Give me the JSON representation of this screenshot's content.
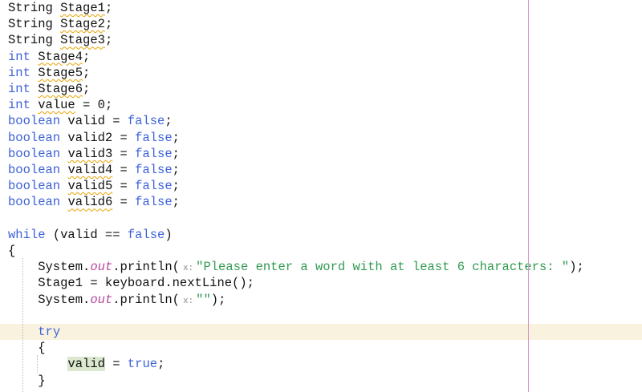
{
  "editor": {
    "current_line": 20,
    "lines": [
      [
        [
          "String ",
          ""
        ],
        [
          "Stage1",
          "w"
        ],
        [
          ";",
          ""
        ]
      ],
      [
        [
          "String ",
          ""
        ],
        [
          "Stage2",
          "w"
        ],
        [
          ";",
          ""
        ]
      ],
      [
        [
          "String ",
          ""
        ],
        [
          "Stage3",
          "w"
        ],
        [
          ";",
          ""
        ]
      ],
      [
        [
          "int",
          "k"
        ],
        [
          " ",
          ""
        ],
        [
          "Stage4",
          "w"
        ],
        [
          ";",
          ""
        ]
      ],
      [
        [
          "int",
          "k"
        ],
        [
          " ",
          ""
        ],
        [
          "Stage5",
          "w"
        ],
        [
          ";",
          ""
        ]
      ],
      [
        [
          "int",
          "k"
        ],
        [
          " ",
          ""
        ],
        [
          "Stage6",
          "w"
        ],
        [
          ";",
          ""
        ]
      ],
      [
        [
          "int",
          "k"
        ],
        [
          " ",
          ""
        ],
        [
          "value",
          "w"
        ],
        [
          " = 0;",
          ""
        ]
      ],
      [
        [
          "boolean",
          "k"
        ],
        [
          " valid = ",
          ""
        ],
        [
          "false",
          "k"
        ],
        [
          ";",
          ""
        ]
      ],
      [
        [
          "boolean",
          "k"
        ],
        [
          " valid2 = ",
          ""
        ],
        [
          "false",
          "k"
        ],
        [
          ";",
          ""
        ]
      ],
      [
        [
          "boolean",
          "k"
        ],
        [
          " ",
          ""
        ],
        [
          "valid3",
          "w"
        ],
        [
          " = ",
          ""
        ],
        [
          "false",
          "k"
        ],
        [
          ";",
          ""
        ]
      ],
      [
        [
          "boolean",
          "k"
        ],
        [
          " ",
          ""
        ],
        [
          "valid4",
          "w"
        ],
        [
          " = ",
          ""
        ],
        [
          "false",
          "k"
        ],
        [
          ";",
          ""
        ]
      ],
      [
        [
          "boolean",
          "k"
        ],
        [
          " ",
          ""
        ],
        [
          "valid5",
          "w"
        ],
        [
          " = ",
          ""
        ],
        [
          "false",
          "k"
        ],
        [
          ";",
          ""
        ]
      ],
      [
        [
          "boolean",
          "k"
        ],
        [
          " ",
          ""
        ],
        [
          "valid6",
          "w"
        ],
        [
          " = ",
          ""
        ],
        [
          "false",
          "k"
        ],
        [
          ";",
          ""
        ]
      ],
      [],
      [
        [
          "while",
          "k"
        ],
        [
          " (valid == ",
          ""
        ],
        [
          "false",
          "k"
        ],
        [
          ")",
          ""
        ]
      ],
      [
        [
          "{",
          ""
        ]
      ],
      [
        [
          "    System.",
          ""
        ],
        [
          "out",
          "f"
        ],
        [
          ".println(",
          ""
        ],
        [
          "x:",
          "h"
        ],
        [
          "\"Please enter a word with at least 6 characters: \"",
          "s"
        ],
        [
          ");",
          ""
        ]
      ],
      [
        [
          "    Stage1 = keyboard.nextLine();",
          ""
        ]
      ],
      [
        [
          "    System.",
          ""
        ],
        [
          "out",
          "f"
        ],
        [
          ".println(",
          ""
        ],
        [
          "x:",
          "h"
        ],
        [
          "\"\"",
          "s"
        ],
        [
          ");",
          ""
        ]
      ],
      [],
      [
        [
          "    ",
          ""
        ],
        [
          "try",
          "k"
        ]
      ],
      [
        [
          "    {",
          ""
        ]
      ],
      [
        [
          "        ",
          ""
        ],
        [
          "valid",
          "hl"
        ],
        [
          " = ",
          ""
        ],
        [
          "true",
          "k"
        ],
        [
          ";",
          ""
        ]
      ],
      [
        [
          "    }",
          ""
        ]
      ]
    ]
  }
}
